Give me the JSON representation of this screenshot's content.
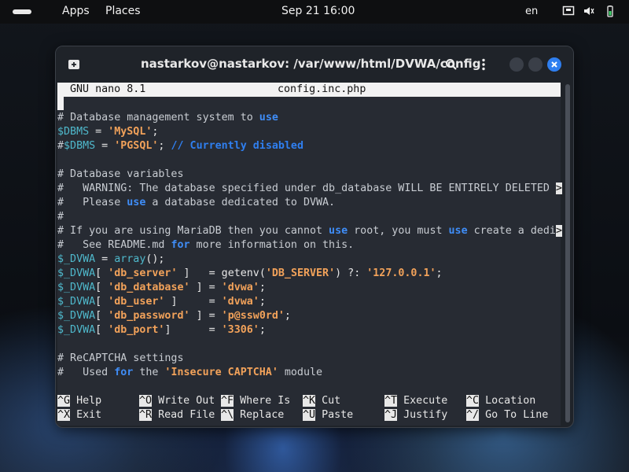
{
  "topbar": {
    "apps": "Apps",
    "places": "Places",
    "clock": "Sep 21  16:00",
    "lang": "en"
  },
  "window": {
    "title": "nastarkov@nastarkov: /var/www/html/DVWA/config"
  },
  "nano": {
    "version": "GNU nano 8.1",
    "filename": "config.inc.php",
    "more_marker": ">"
  },
  "code": {
    "l1_hash": "# ",
    "l1_text": "Database management system to ",
    "l1_kw": "use",
    "l2_var": "$DBMS",
    "l2_op": " = ",
    "l2_str": "'MySQL'",
    "l2_end": ";",
    "l3_hash": "#",
    "l3_var": "$DBMS",
    "l3_op": " = ",
    "l3_str": "'PGSQL'",
    "l3_end": "; ",
    "l3_comment": "// Currently disabled",
    "l5": "# Database variables",
    "l6": "#   WARNING: The database specified under db_database WILL BE ENTIRELY DELETED ",
    "l7_a": "#   Please ",
    "l7_kw": "use",
    "l7_b": " a database dedicated to DVWA.",
    "l8": "#",
    "l9_a": "# If you are using MariaDB then you cannot ",
    "l9_kw1": "use",
    "l9_b": " root, you must ",
    "l9_kw2": "use",
    "l9_c": " create a dedi",
    "l10_a": "#   See README.md ",
    "l10_kw": "for",
    "l10_b": " more information on this.",
    "l11_var": "$_DVWA",
    "l11_b": " = ",
    "l11_fn": "array",
    "l11_c": "();",
    "l12_var": "$_DVWA",
    "l12_a": "[ ",
    "l12_key": "'db_server'",
    "l12_b": " ]   = getenv(",
    "l12_arg": "'DB_SERVER'",
    "l12_c": ") ?: ",
    "l12_val": "'127.0.0.1'",
    "l12_d": ";",
    "l13_var": "$_DVWA",
    "l13_a": "[ ",
    "l13_key": "'db_database'",
    "l13_b": " ] = ",
    "l13_val": "'dvwa'",
    "l13_c": ";",
    "l14_var": "$_DVWA",
    "l14_a": "[ ",
    "l14_key": "'db_user'",
    "l14_b": " ]     = ",
    "l14_val": "'dvwa'",
    "l14_c": ";",
    "l15_var": "$_DVWA",
    "l15_a": "[ ",
    "l15_key": "'db_password'",
    "l15_b": " ] = ",
    "l15_val": "'p@ssw0rd'",
    "l15_c": ";",
    "l16_var": "$_DVWA",
    "l16_a": "[ ",
    "l16_key": "'db_port'",
    "l16_b": "]      = ",
    "l16_val": "'3306'",
    "l16_c": ";",
    "l18": "# ReCAPTCHA settings",
    "l19_a": "#   Used ",
    "l19_kw": "for",
    "l19_b": " the ",
    "l19_str": "'Insecure CAPTCHA'",
    "l19_c": " module"
  },
  "shortcuts": [
    {
      "key": "^G",
      "label": " Help"
    },
    {
      "key": "^O",
      "label": " Write Out"
    },
    {
      "key": "^F",
      "label": " Where Is"
    },
    {
      "key": "^K",
      "label": " Cut"
    },
    {
      "key": "^T",
      "label": " Execute"
    },
    {
      "key": "^C",
      "label": " Location"
    },
    {
      "key": "^X",
      "label": " Exit"
    },
    {
      "key": "^R",
      "label": " Read File"
    },
    {
      "key": "^\\",
      "label": " Replace"
    },
    {
      "key": "^U",
      "label": " Paste"
    },
    {
      "key": "^J",
      "label": " Justify"
    },
    {
      "key": "^/",
      "label": " Go To Line"
    }
  ]
}
